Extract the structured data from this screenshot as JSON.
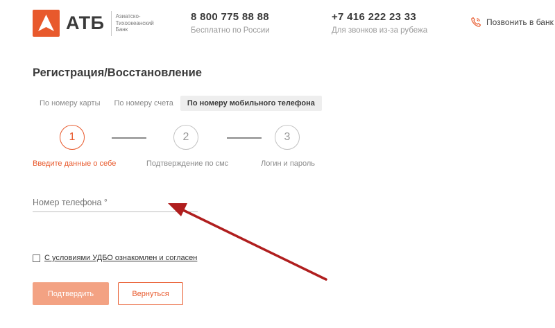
{
  "header": {
    "logo": {
      "name": "АТБ",
      "subtitle": "Азиатско-Тихоокеанский Банк"
    },
    "phones": [
      {
        "number": "8 800 775 88 88",
        "caption": "Бесплатно по России"
      },
      {
        "number": "+7 416 222 23 33",
        "caption": "Для звонков из-за рубежа"
      }
    ],
    "callback_label": "Позвонить в банк"
  },
  "main": {
    "title": "Регистрация/Восстановление",
    "tabs": [
      {
        "label": "По номеру карты"
      },
      {
        "label": "По номеру счета"
      },
      {
        "label": "По номеру мобильного телефона"
      }
    ],
    "steps": [
      {
        "number": "1",
        "label": "Введите данные о себе"
      },
      {
        "number": "2",
        "label": "Подтверждение по смс"
      },
      {
        "number": "3",
        "label": "Логин и пароль"
      }
    ],
    "active_step": 1,
    "phone_field": {
      "placeholder": "Номер телефона °",
      "value": ""
    },
    "agreement": {
      "label": "С условиями УДБО ознакомлен и согласен",
      "checked": false
    },
    "buttons": {
      "confirm": "Подтвердить",
      "back": "Вернуться"
    }
  },
  "colors": {
    "accent": "#e8592c",
    "accent_light": "#f3a283",
    "annotation_arrow": "#b01e1e"
  }
}
